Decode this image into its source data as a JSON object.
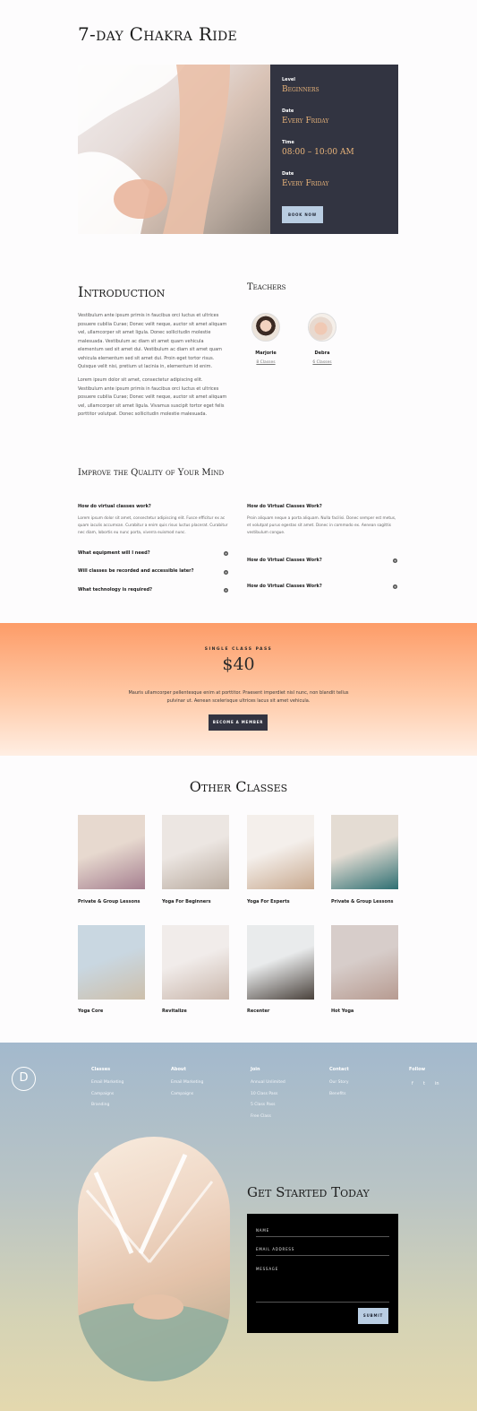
{
  "hero": {
    "title": "7-day Chakra Ride",
    "meta": [
      {
        "label": "Level",
        "value": "Beginners"
      },
      {
        "label": "Date",
        "value": "Every Friday"
      },
      {
        "label": "Time",
        "value": "08:00 – 10:00 AM"
      },
      {
        "label": "Date",
        "value": "Every Friday"
      }
    ],
    "book_button": "BOOK NOW"
  },
  "intro": {
    "title": "Introduction",
    "paragraph1": "Vestibulum ante ipsum primis in faucibus orci luctus et ultrices posuere cubilia Curae; Donec velit neque, auctor sit amet aliquam vel, ullamcorper sit amet ligula. Donec sollicitudin molestie malesuada. Vestibulum ac diam sit amet quam vehicula elementum sed sit amet dui. Vestibulum ac diam sit amet quam vehicula elementum sed sit amet dui. Proin eget tortor risus. Quisque velit nisi, pretium ut lacinia in, elementum id enim.",
    "paragraph2": "Lorem ipsum dolor sit amet, consectetur adipiscing elit. Vestibulum ante ipsum primis in faucibus orci luctus et ultrices posuere cubilia Curae; Donec velit neque, auctor sit amet aliquam vel, ullamcorper sit amet ligula. Vivamus suscipit tortor eget felis porttitor volutpat. Donec sollicitudin molestie malesuada."
  },
  "teachers": {
    "title": "Teachers",
    "items": [
      {
        "name": "Marjorie",
        "count": "8 Classes"
      },
      {
        "name": "Debra",
        "count": "6 Classes"
      }
    ]
  },
  "faq": {
    "title": "Improve the Quality of Your Mind",
    "left": [
      {
        "q": "How do virtual classes work?",
        "a": "Lorem ipsum dolor sit amet, consectetur adipiscing elit. Fusce efficitur ex ac quam iaculis accumsan. Curabitur a enim quis risus luctus placerat. Curabitur nec diam, lobortis eu nunc porta, viverra euismod nunc."
      },
      {
        "q": "What equipment will I need?"
      },
      {
        "q": "Will classes be recorded and accessible later?"
      },
      {
        "q": "What technology is required?"
      }
    ],
    "right": [
      {
        "q": "How do Virtual Classes Work?",
        "a": "Proin aliquam neque a porta aliquam. Nulla facilisi. Donec semper est metus, et volutpat purus egestas sit amet. Donec in commodo ex. Aenean sagittis vestibulum congue."
      },
      {
        "q": "How do Virtual Classes Work?"
      },
      {
        "q": "How do Virtual Classes Work?"
      }
    ]
  },
  "pass": {
    "label": "SINGLE CLASS PASS",
    "price": "$40",
    "text": "Mauris ullamcorper pellentesque enim at porttitor. Praesent imperdiet nisl nunc, non blandit tellus pulvinar ut. Aenean scelerisque ultrices lacus sit amet vehicula.",
    "button": "BECOME A MEMBER"
  },
  "other_classes": {
    "title": "Other Classes",
    "items": [
      {
        "label": "Private & Group Lessons",
        "color_a": "#e7d9cf",
        "color_b": "#a57f8f"
      },
      {
        "label": "Yoga For Beginners",
        "color_a": "#ece6e2",
        "color_b": "#b9ab9f"
      },
      {
        "label": "Yoga For Experts",
        "color_a": "#f4efeb",
        "color_b": "#c8a98f"
      },
      {
        "label": "Private & Group Lessons",
        "color_a": "#e4dcd3",
        "color_b": "#2e6f72"
      },
      {
        "label": "Yoga Core",
        "color_a": "#c9d7e1",
        "color_b": "#cdbfab"
      },
      {
        "label": "Revitalize",
        "color_a": "#f1ecea",
        "color_b": "#c9b6ab"
      },
      {
        "label": "Recenter",
        "color_a": "#e9ebec",
        "color_b": "#4a423c"
      },
      {
        "label": "Hot Yoga",
        "color_a": "#d7cdca",
        "color_b": "#b79b91"
      }
    ]
  },
  "footer": {
    "logo": "D",
    "columns": [
      {
        "heading": "Classes",
        "items": [
          "Email Marketing",
          "Campaigns",
          "Branding"
        ]
      },
      {
        "heading": "About",
        "items": [
          "Email Marketing",
          "Campaigns"
        ]
      },
      {
        "heading": "Join",
        "items": [
          "Annual Unlimited",
          "10 Class Pass",
          "5 Class Pass",
          "Free Class"
        ]
      },
      {
        "heading": "Contact",
        "items": [
          "Our Story",
          "Benefits"
        ]
      }
    ],
    "follow": {
      "heading": "Follow",
      "icons": [
        "f",
        "t",
        "in"
      ]
    }
  },
  "get_started": {
    "title": "Get Started Today",
    "name_label": "NAME",
    "email_label": "EMAIL ADDRESS",
    "message_label": "MESSAGE",
    "submit": "SUBMIT"
  }
}
